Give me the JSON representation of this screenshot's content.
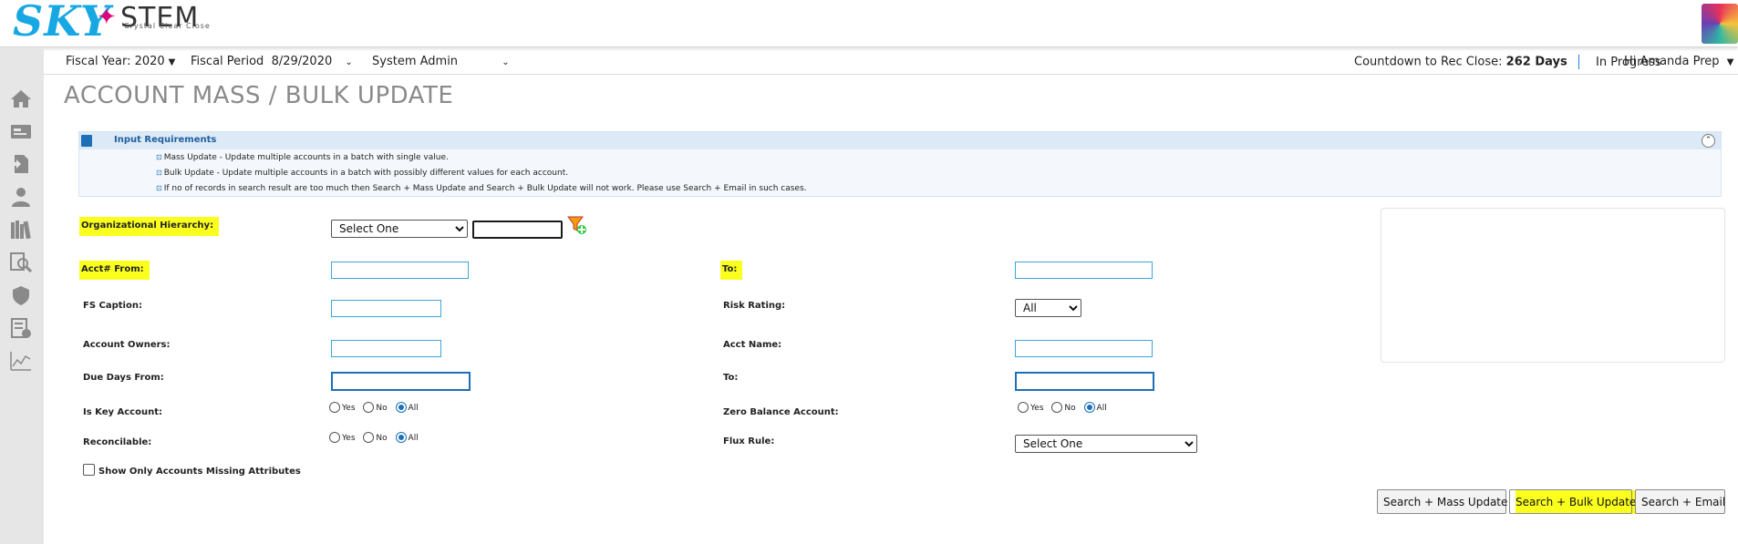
{
  "brand": {
    "logo_left": "SKY",
    "logo_right": "STEM",
    "tagline": "Crystal Clear Close"
  },
  "header": {
    "fiscal_year": "Fiscal Year: 2020",
    "fiscal_period_label": "Fiscal Period",
    "fiscal_period_value": "8/29/2020",
    "role": "System Admin",
    "countdown_label": "Countdown to Rec Close:",
    "countdown_value": "262 Days",
    "status": "In Progress",
    "user_greeting": "Hi Amanda Prep"
  },
  "sidebar": {
    "icons": [
      "home-icon",
      "card-icon",
      "document-icon",
      "user-icon",
      "books-icon",
      "search-doc-icon",
      "shield-icon",
      "checklist-icon",
      "chart-icon"
    ]
  },
  "page": {
    "title": "ACCOUNT MASS / BULK UPDATE"
  },
  "requirements": {
    "title": "Input Requirements",
    "lines": [
      "Mass Update - Update multiple accounts in a batch with single value.",
      "Bulk Update - Update multiple accounts in a batch with possibly different values for each account.",
      "If no of records in search result are too much then Search + Mass Update and Search + Bulk Update will not work. Please use Search + Email in such cases."
    ]
  },
  "form": {
    "org_hierarchy_label": "Organizational Hierarchy:",
    "org_hierarchy_select": "Select One",
    "org_hierarchy_text": "",
    "acct_from_label": "Acct# From:",
    "acct_from_value": "",
    "acct_to_label": "To:",
    "acct_to_value": "",
    "fs_caption_label": "FS Caption:",
    "fs_caption_value": "",
    "risk_rating_label": "Risk Rating:",
    "risk_rating_value": "All",
    "account_owners_label": "Account Owners:",
    "account_owners_value": "",
    "acct_name_label": "Acct Name:",
    "acct_name_value": "",
    "due_days_from_label": "Due Days From:",
    "due_days_from_value": "",
    "due_days_to_label": "To:",
    "due_days_to_value": "",
    "is_key_label": "Is Key Account:",
    "zero_balance_label": "Zero Balance Account:",
    "reconcilable_label": "Reconcilable:",
    "flux_rule_label": "Flux Rule:",
    "flux_rule_value": "Select One",
    "radio_yes": "Yes",
    "radio_no": "No",
    "radio_all": "All",
    "missing_attrs_label": "Show Only Accounts Missing Attributes"
  },
  "buttons": {
    "mass_update": "Search + Mass Update",
    "bulk_update": "Search + Bulk Update",
    "email": "Search + Email"
  },
  "colors": {
    "highlight": "#fbff1e",
    "accent": "#1d6fb8",
    "input_border": "#3aa7d8"
  }
}
